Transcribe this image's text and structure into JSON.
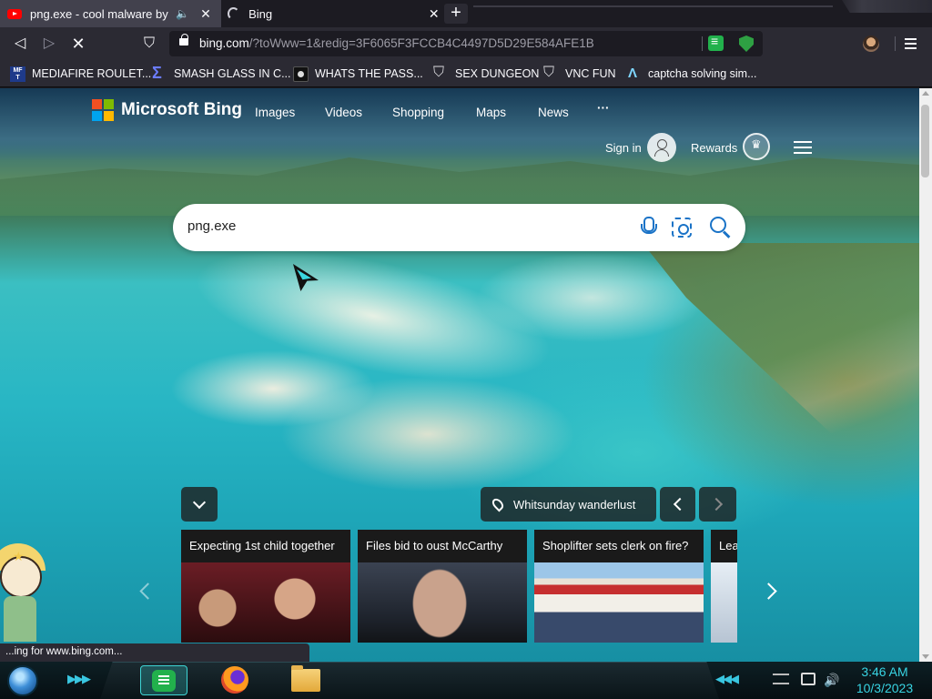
{
  "browser": {
    "tabs": [
      {
        "title": "png.exe - cool malware by @r",
        "favicon": "youtube-icon"
      },
      {
        "title": "Bing",
        "favicon": "loading-spinner"
      }
    ],
    "url": {
      "domain": "bing.com",
      "path": "/?toWww=1&redig=3F6065F3FCCB4C4497D5D29E584AFE1B"
    },
    "bookmarks": [
      {
        "label": "MEDIAFIRE ROULET...",
        "icon_text": "MF\nT"
      },
      {
        "label": "SMASH GLASS IN C..."
      },
      {
        "label": "WHATS THE PASS..."
      },
      {
        "label": "SEX DUNGEON"
      },
      {
        "label": "VNC FUN"
      },
      {
        "label": "captcha solving sim..."
      }
    ],
    "status": "...ing for www.bing.com..."
  },
  "bing": {
    "brand": "Microsoft Bing",
    "logo_colors": [
      "#f25022",
      "#7fba00",
      "#00a4ef",
      "#ffb900"
    ],
    "nav": [
      "Images",
      "Videos",
      "Shopping",
      "Maps",
      "News",
      "···"
    ],
    "sign_in": "Sign in",
    "rewards": "Rewards",
    "search_value": "png.exe",
    "location_label": "Whitsunday wanderlust",
    "news": [
      {
        "title": "Expecting 1st child together"
      },
      {
        "title": "Files bid to oust McCarthy"
      },
      {
        "title": "Shoplifter sets clerk on fire?"
      },
      {
        "title": "Lea"
      }
    ]
  },
  "taskbar": {
    "time": "3:46 AM",
    "date": "10/3/2023"
  }
}
